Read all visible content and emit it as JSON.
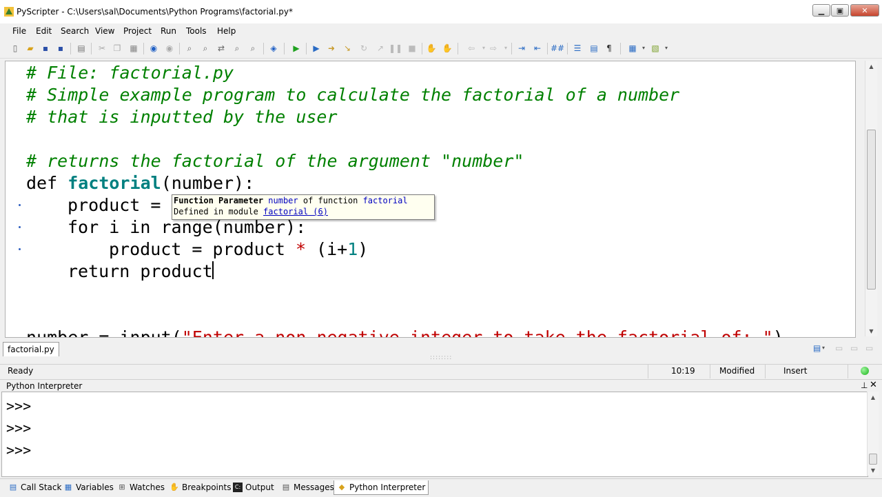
{
  "window": {
    "title": "PyScripter - C:\\Users\\sal\\Documents\\Python Programs\\factorial.py*"
  },
  "menu": [
    "File",
    "Edit",
    "Search",
    "View",
    "Project",
    "Run",
    "Tools",
    "Help"
  ],
  "editor": {
    "lines": [
      "# File: factorial.py",
      "# Simple example program to calculate the factorial of a number",
      "# that is inputted by the user",
      "# returns the factorial of the argument \"number\"",
      "def",
      "factorial",
      "(number):",
      "product = ",
      "for i in range(number):",
      "product = product ",
      "*",
      " (i+",
      "1",
      ")",
      "return product",
      "number = input(",
      "\"Enter a non-negative integer to take the factorial of: \"",
      ")"
    ]
  },
  "tooltip": {
    "line1_a": "Function Parameter ",
    "line1_b": "number",
    "line1_c": " of function ",
    "line1_d": "factorial",
    "line2_a": "Defined in module ",
    "line2_link": "factorial (6)"
  },
  "file_tab": "factorial.py",
  "status": {
    "state": "Ready",
    "position": "10:19",
    "modified": "Modified",
    "mode": "Insert",
    "indicator_color": "#18b318"
  },
  "interpreter": {
    "title": "Python Interpreter",
    "prompts": [
      ">>>",
      ">>>",
      ">>>"
    ]
  },
  "bottom_tabs": [
    {
      "label": "Call Stack",
      "icon": "call-stack-icon"
    },
    {
      "label": "Variables",
      "icon": "variables-icon"
    },
    {
      "label": "Watches",
      "icon": "watches-icon"
    },
    {
      "label": "Breakpoints",
      "icon": "breakpoints-icon"
    },
    {
      "label": "Output",
      "icon": "output-icon"
    },
    {
      "label": "Messages",
      "icon": "messages-icon"
    },
    {
      "label": "Python Interpreter",
      "icon": "python-interpreter-icon"
    }
  ]
}
